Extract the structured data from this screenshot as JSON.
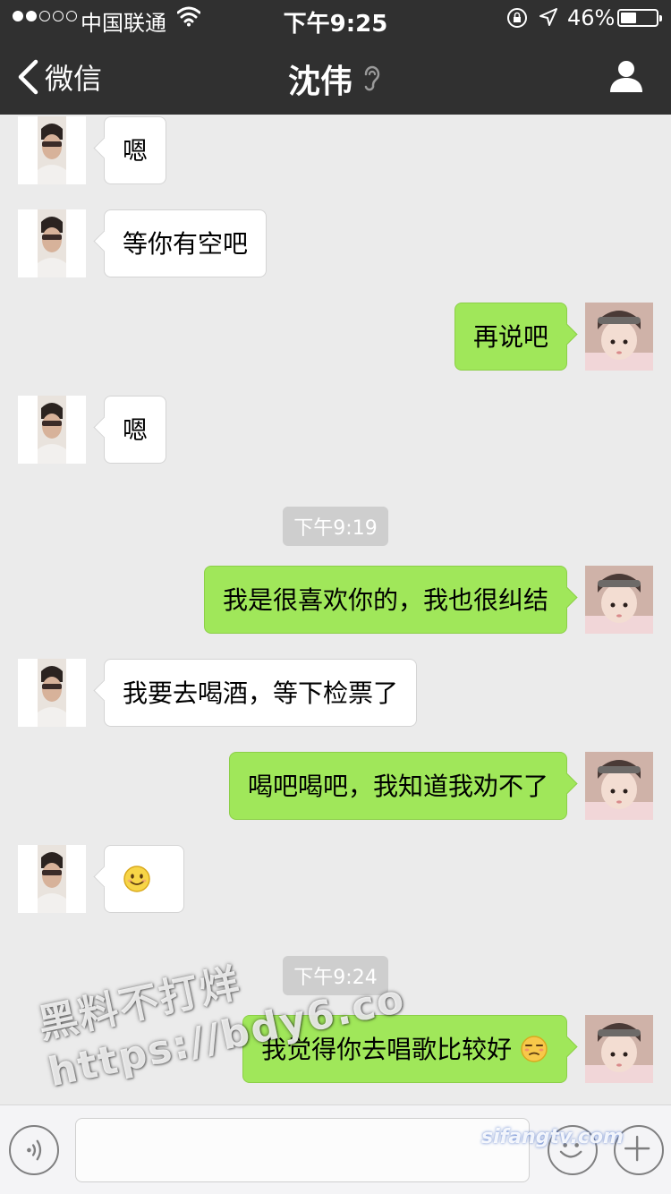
{
  "status_bar": {
    "carrier": "中国联通",
    "time": "下午9:25",
    "battery_percent_text": "46%",
    "battery_level": 0.46
  },
  "nav": {
    "back_label": "微信",
    "title": "沈伟"
  },
  "messages": [
    {
      "side": "left",
      "text": "嗯"
    },
    {
      "side": "left",
      "text": "等你有空吧"
    },
    {
      "side": "right",
      "text": "再说吧"
    },
    {
      "side": "left",
      "text": "嗯"
    },
    {
      "timestamp": "下午9:19"
    },
    {
      "side": "right",
      "text": "我是很喜欢你的，我也很纠结"
    },
    {
      "side": "left",
      "text": "我要去喝酒，等下检票了"
    },
    {
      "side": "right",
      "text": "喝吧喝吧，我知道我劝不了"
    },
    {
      "side": "left",
      "text": "",
      "emoji": "smile-emoji"
    },
    {
      "timestamp": "下午9:24"
    },
    {
      "side": "right",
      "text": "我觉得你去唱歌比较好",
      "emoji": "unamused-emoji"
    }
  ],
  "watermarks": {
    "line1": "黑料不打烊",
    "line2": "https://bdy6.co",
    "corner": "sifangtv.com"
  },
  "colors": {
    "nav_bg": "#303030",
    "chat_bg": "#ebebeb",
    "bubble_sent": "#a0e75a",
    "bubble_received": "#ffffff",
    "timestamp_bg": "#cecece"
  }
}
